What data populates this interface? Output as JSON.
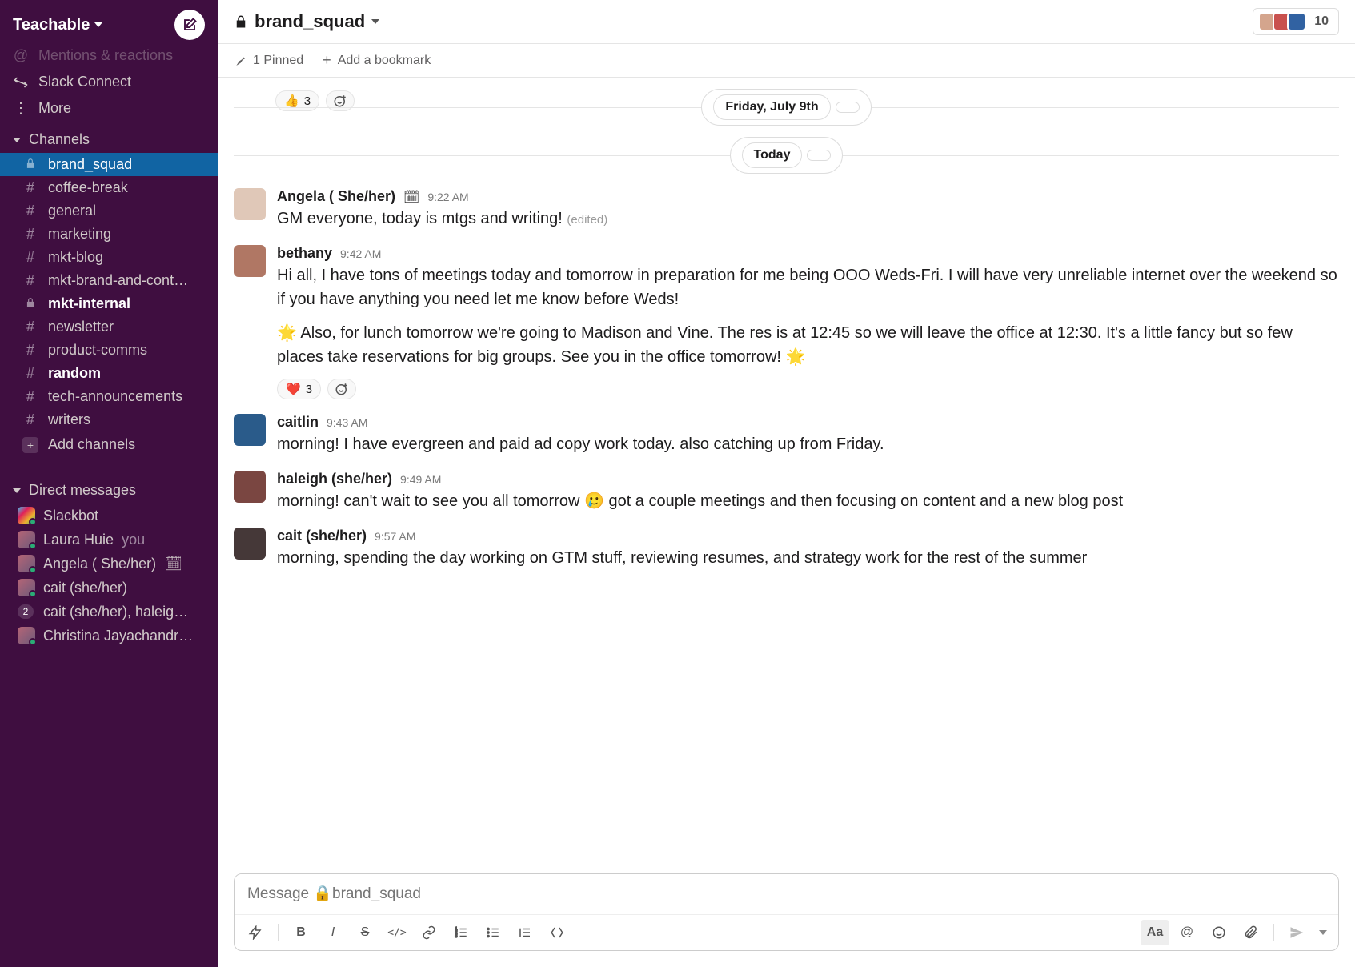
{
  "workspace": {
    "name": "Teachable"
  },
  "nav": {
    "mentions": "Mentions & reactions",
    "slack_connect": "Slack Connect",
    "more": "More"
  },
  "sections": {
    "channels_label": "Channels",
    "dms_label": "Direct messages",
    "add_channels": "Add channels"
  },
  "channels": {
    "items": [
      {
        "name": "brand_squad",
        "prefix": "lock",
        "active": true,
        "bold": false
      },
      {
        "name": "coffee-break",
        "prefix": "#",
        "active": false,
        "bold": false
      },
      {
        "name": "general",
        "prefix": "#",
        "active": false,
        "bold": false
      },
      {
        "name": "marketing",
        "prefix": "#",
        "active": false,
        "bold": false
      },
      {
        "name": "mkt-blog",
        "prefix": "#",
        "active": false,
        "bold": false
      },
      {
        "name": "mkt-brand-and-cont…",
        "prefix": "#",
        "active": false,
        "bold": false
      },
      {
        "name": "mkt-internal",
        "prefix": "lock",
        "active": false,
        "bold": true
      },
      {
        "name": "newsletter",
        "prefix": "#",
        "active": false,
        "bold": false
      },
      {
        "name": "product-comms",
        "prefix": "#",
        "active": false,
        "bold": false
      },
      {
        "name": "random",
        "prefix": "#",
        "active": false,
        "bold": true
      },
      {
        "name": "tech-announcements",
        "prefix": "#",
        "active": false,
        "bold": false
      },
      {
        "name": "writers",
        "prefix": "#",
        "active": false,
        "bold": false
      }
    ]
  },
  "dms": {
    "items": [
      {
        "name": "Slackbot",
        "you": "",
        "badge": "",
        "status_emoji": "",
        "avatar": "slackbot"
      },
      {
        "name": "Laura Huie",
        "you": "you",
        "badge": "",
        "status_emoji": ""
      },
      {
        "name": "Angela ( She/her)",
        "you": "",
        "badge": "",
        "status_emoji": "🗓"
      },
      {
        "name": "cait (she/her)",
        "you": "",
        "badge": "",
        "status_emoji": ""
      },
      {
        "name": "cait (she/her), haleig…",
        "you": "",
        "badge": "2",
        "status_emoji": ""
      },
      {
        "name": "Christina Jayachandr…",
        "you": "",
        "badge": "",
        "status_emoji": ""
      }
    ]
  },
  "header": {
    "channel_name": "brand_squad",
    "members": "10",
    "pinned": "1 Pinned",
    "add_bookmark": "Add a bookmark"
  },
  "date_pills": {
    "friday": "Friday, July 9th",
    "today": "Today"
  },
  "top_partial": {
    "reaction_emoji": "👍",
    "reaction_count": "3"
  },
  "messages": [
    {
      "author": "Angela ( She/her)",
      "status_emoji": "🗓",
      "time": "9:22 AM",
      "text": "GM everyone, today is mtgs and writing!",
      "edited": "(edited)",
      "avatar": "#e0c8b8"
    },
    {
      "author": "bethany",
      "time": "9:42 AM",
      "p1": "Hi all, I have tons of meetings today and tomorrow in preparation for me being OOO Weds-Fri. I will have very unreliable internet over the weekend so if you have anything you need let me know before Weds!",
      "p2": "🌟 Also, for lunch tomorrow we're going to Madison and Vine. The res is at 12:45 so we will leave the office at 12:30. It's a little fancy but so few places take reservations for big groups. See you in the office tomorrow! 🌟",
      "reaction_emoji": "❤️",
      "reaction_count": "3",
      "avatar": "#b07764"
    },
    {
      "author": "caitlin",
      "time": "9:43 AM",
      "text": "morning! I have evergreen and paid ad copy work today. also catching up from Friday.",
      "avatar": "#2a5b8a"
    },
    {
      "author": "haleigh (she/her)",
      "time": "9:49 AM",
      "text_a": "morning! can't wait to see you all tomorrow ",
      "emoji": "🥲",
      "text_b": " got a couple meetings and then focusing on content and a new blog post",
      "avatar": "#7a4641"
    },
    {
      "author": "cait (she/her)",
      "time": "9:57 AM",
      "text": "morning, spending the day working on GTM stuff, reviewing resumes, and strategy work for the rest of the summer",
      "avatar": "#453838"
    }
  ],
  "composer": {
    "placeholder": "Message 🔒brand_squad"
  },
  "avatars_header_colors": [
    "#d4a58d",
    "#c9514e",
    "#3162a2"
  ]
}
